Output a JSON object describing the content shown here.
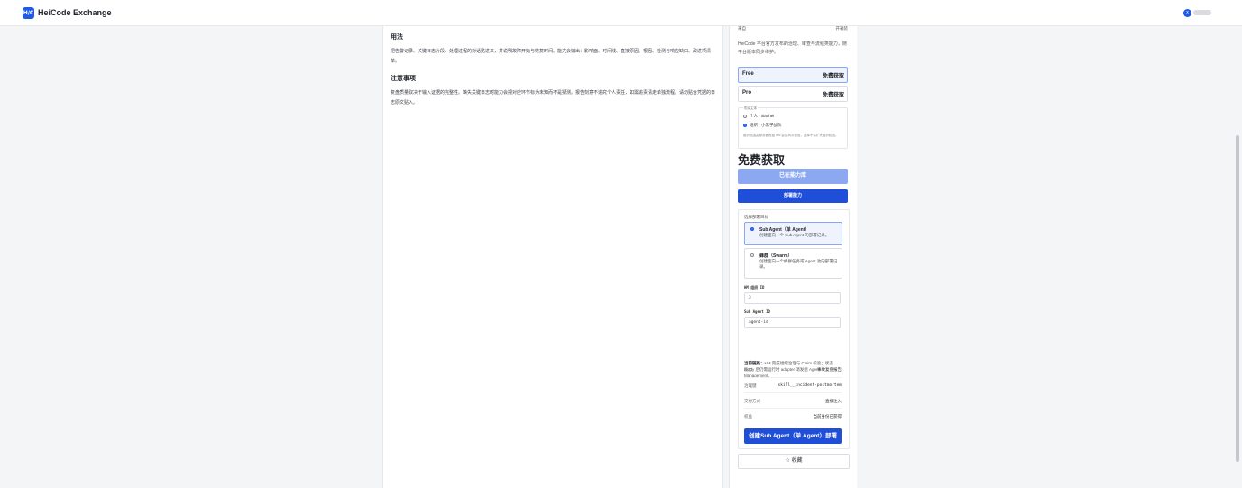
{
  "header": {
    "logo_text": "H/C",
    "brand": "HeiCode Exchange",
    "avatar_initial": "x"
  },
  "article": {
    "usage_heading": "用法",
    "usage_text": "把告警记录、关键日志片段、处理过程的对话贴进来，并说明故障开始与恢复时间。能力会输出：影响面、时间线、直接原因、根因、检测与响应缺口、改进项清单。",
    "notes_heading": "注意事项",
    "notes_text": "复盘质量取决于输入证据的完整性。缺失关键日志时能力会把对应环节标为未知而不是猜测。报告刻意不追究个人责任，如需追责请走单独流程。请勿贴含凭据的日志原文贴入。"
  },
  "sidebar": {
    "top_row": {
      "label": "来自",
      "value": "开箱装"
    },
    "description": "HeiCode 平台官方发布的治理、审查与流程类能力，随平台版本同步维护。",
    "plans": [
      {
        "name": "Free",
        "price": "免费获取"
      },
      {
        "name": "Pro",
        "price": "免费获取"
      }
    ],
    "buyer": {
      "legend": "购买主体",
      "options": [
        "个人 · xiaohei",
        "组织 · 小黑子战队"
      ],
      "note": "组织范围由服务器根据 HM 会话再次校验，选择不会扩大组织权限。"
    },
    "big_price": "免费获取",
    "library_button": "已在能力库",
    "deploy_button": "部署能力",
    "deploy": {
      "title": "选择部署目标",
      "targets": [
        {
          "name": "Sub Agent（单 Agent）",
          "desc": "创建面向一个 Sub Agent 的部署记录。"
        },
        {
          "name": "蜂群（Swarm）",
          "desc": "创建面向一个蜂群任务或 Agent 池的部署记录。"
        }
      ],
      "hm_org_label": "HM 组织 ID",
      "hm_org_value": "3",
      "sub_agent_label": "Sub Agent ID",
      "sub_agent_placeholder": "agent-id",
      "status_label": "当前链路：",
      "status_text": "HM 完成组织治理与 Claim 校验；状态 ready 后仍需运行时 adapter 消发组 Agent Management。",
      "details": [
        {
          "k": "能力",
          "v": "事故复盘报告"
        },
        {
          "k": "治理键",
          "v": "skill__incident-postmortem"
        },
        {
          "k": "交付方式",
          "v": "直接注入"
        },
        {
          "k": "权益",
          "v": "当前身份已获得"
        }
      ],
      "create_button": "创建Sub Agent（单 Agent）部署"
    },
    "favorite_button": "☆ 收藏"
  }
}
